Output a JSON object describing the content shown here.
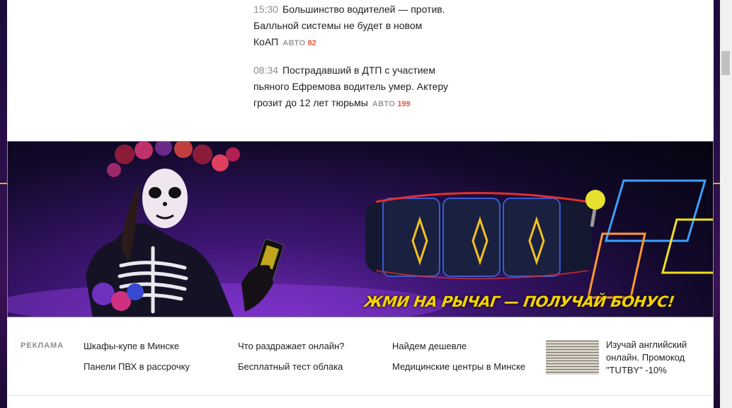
{
  "news": [
    {
      "time": "15:30",
      "title": "Большинство водителей — против. Балльной системы не будет в новом КоАП",
      "tag": "АВТО",
      "count": "82"
    },
    {
      "time": "08:34",
      "title": "Пострадавший в ДТП с участием пьяного Ефремова водитель умер. Актеру грозит до 12 лет тюрьмы",
      "tag": "АВТО",
      "count": "199"
    }
  ],
  "banner": {
    "slogan": "ЖМИ НА РЫЧАГ —   ПОЛУЧАЙ БОНУС!"
  },
  "ads": {
    "label": "РЕКЛАМА",
    "links": [
      "Шкафы-купе в Минске",
      "Панели ПВХ в рассрочку",
      "Что раздражает онлайн?",
      "Бесплатный тест облака",
      "Найдем дешевле",
      "Медицинские центры в Минске"
    ],
    "promo": "Изучай английский онлайн. Промокод \"TUTBY\" -10%"
  },
  "colors": {
    "accent_count": "#e05a3a",
    "banner_text": "#f5d200"
  }
}
